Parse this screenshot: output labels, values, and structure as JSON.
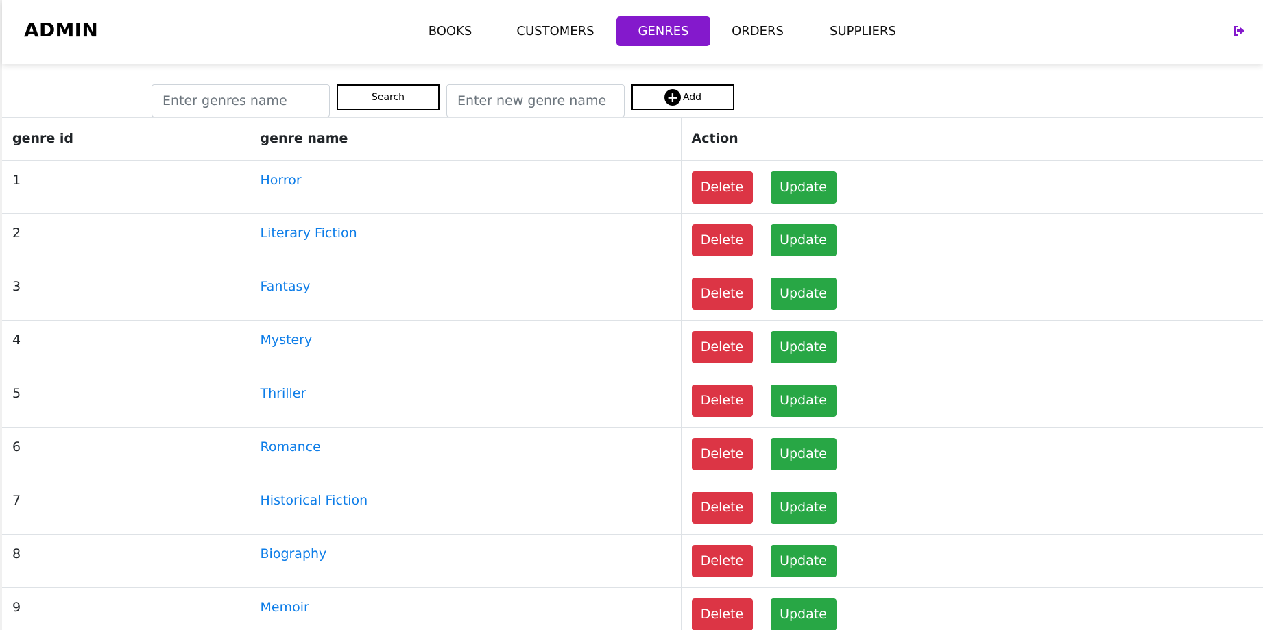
{
  "app": {
    "brand": "ADMIN"
  },
  "nav": {
    "items": [
      {
        "label": "BOOKS",
        "active": false
      },
      {
        "label": "CUSTOMERS",
        "active": false
      },
      {
        "label": "GENRES",
        "active": true
      },
      {
        "label": "ORDERS",
        "active": false
      },
      {
        "label": "SUPPLIERS",
        "active": false
      }
    ],
    "logout_icon": "sign-out-icon",
    "active_color": "#8419cc"
  },
  "toolbar": {
    "search_placeholder": "Enter genres name",
    "search_value": "",
    "search_label": "Search",
    "new_genre_placeholder": "Enter new genre name",
    "new_genre_value": "",
    "add_label": "Add",
    "add_icon": "plus-circle-icon"
  },
  "table": {
    "headers": [
      "genre id",
      "genre name",
      "Action"
    ],
    "rows": [
      {
        "id": "1",
        "name": "Horror"
      },
      {
        "id": "2",
        "name": "Literary Fiction"
      },
      {
        "id": "3",
        "name": "Fantasy"
      },
      {
        "id": "4",
        "name": "Mystery"
      },
      {
        "id": "5",
        "name": "Thriller"
      },
      {
        "id": "6",
        "name": "Romance"
      },
      {
        "id": "7",
        "name": "Historical Fiction"
      },
      {
        "id": "8",
        "name": "Biography"
      },
      {
        "id": "9",
        "name": "Memoir"
      }
    ],
    "delete_label": "Delete",
    "update_label": "Update",
    "link_color": "#0d7de8",
    "delete_color": "#dc3545",
    "update_color": "#28a745"
  }
}
